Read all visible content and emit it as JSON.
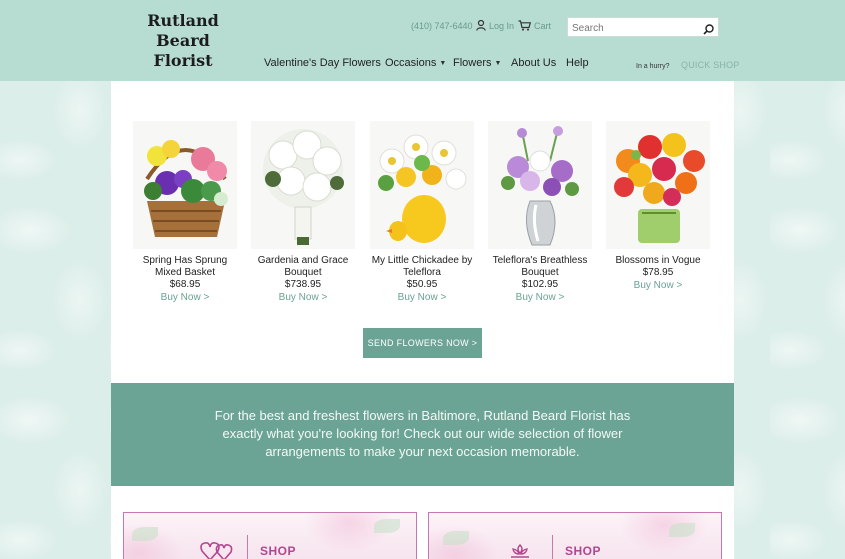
{
  "header": {
    "logo_line1": "Rutland Beard",
    "logo_line2": "Florist",
    "phone": "(410) 747-6440",
    "login_label": "Log In",
    "cart_label": "Cart",
    "search_placeholder": "Search",
    "hurry_label": "In a hurry?",
    "quickshop_label": "QUICK SHOP"
  },
  "nav": {
    "items": [
      {
        "label": "Valentine's Day Flowers"
      },
      {
        "label": "Occasions"
      },
      {
        "label": "Flowers"
      },
      {
        "label": "About Us"
      },
      {
        "label": "Help"
      }
    ]
  },
  "products": [
    {
      "name_line1": "Spring Has Sprung",
      "name_line2": "Mixed Basket",
      "price": "$68.95",
      "buy": "Buy Now >"
    },
    {
      "name_line1": "Gardenia and Grace",
      "name_line2": "Bouquet",
      "price": "$738.95",
      "buy": "Buy Now >"
    },
    {
      "name_line1": "My Little Chickadee by",
      "name_line2": "Teleflora",
      "price": "$50.95",
      "buy": "Buy Now >"
    },
    {
      "name_line1": "Teleflora's Breathless",
      "name_line2": "Bouquet",
      "price": "$102.95",
      "buy": "Buy Now >"
    },
    {
      "name_line1": "Blossoms in Vogue",
      "name_line2": "",
      "price": "$78.95",
      "buy": "Buy Now >"
    }
  ],
  "send_button": "SEND FLOWERS NOW >",
  "band": {
    "text": "For the best and freshest flowers in Baltimore, Rutland Beard Florist has exactly what you're looking for! Check out our wide selection of flower arrangements to make your next occasion memorable."
  },
  "shop_cards": [
    {
      "label": "SHOP",
      "icon": "heart-icon"
    },
    {
      "label": "SHOP",
      "icon": "flower-icon"
    }
  ],
  "colors": {
    "header_bg": "#b7ddd2",
    "accent": "#6ba394",
    "shop_pink": "#b0478f"
  }
}
